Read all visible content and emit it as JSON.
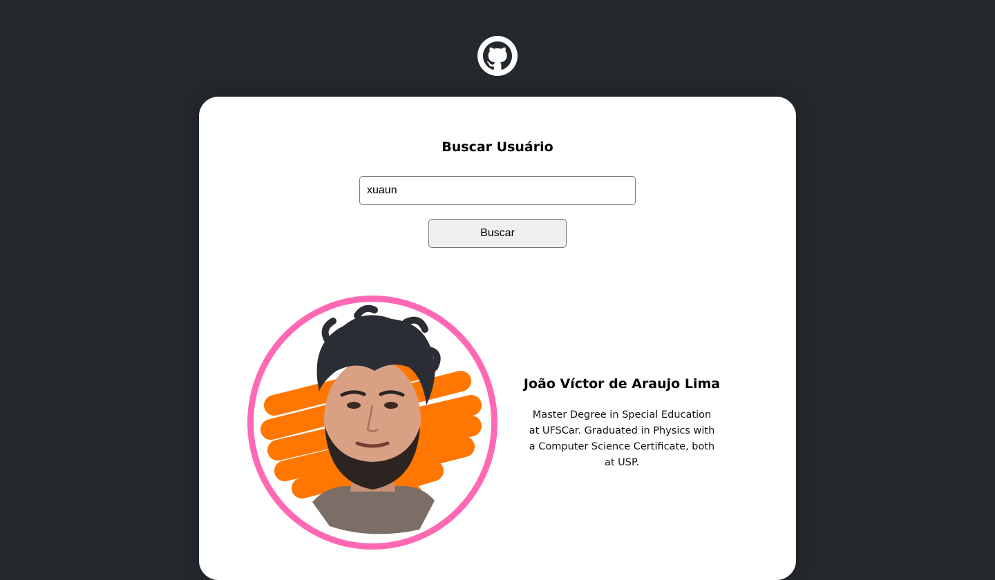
{
  "brand": {
    "icon": "github-icon"
  },
  "search": {
    "title": "Buscar Usuário",
    "input_value": "xuaun",
    "button_label": "Buscar"
  },
  "profile": {
    "name": "João Víctor de Araujo Lima",
    "bio": "Master Degree in Special Education at UFSCar. Graduated in Physics with a Computer Science Certificate, both at USP.",
    "avatar_border_color": "#ff69b4"
  },
  "colors": {
    "background": "#24292e",
    "card": "#ffffff",
    "accent": "#ff69b4",
    "scribble": "#ff7700"
  }
}
